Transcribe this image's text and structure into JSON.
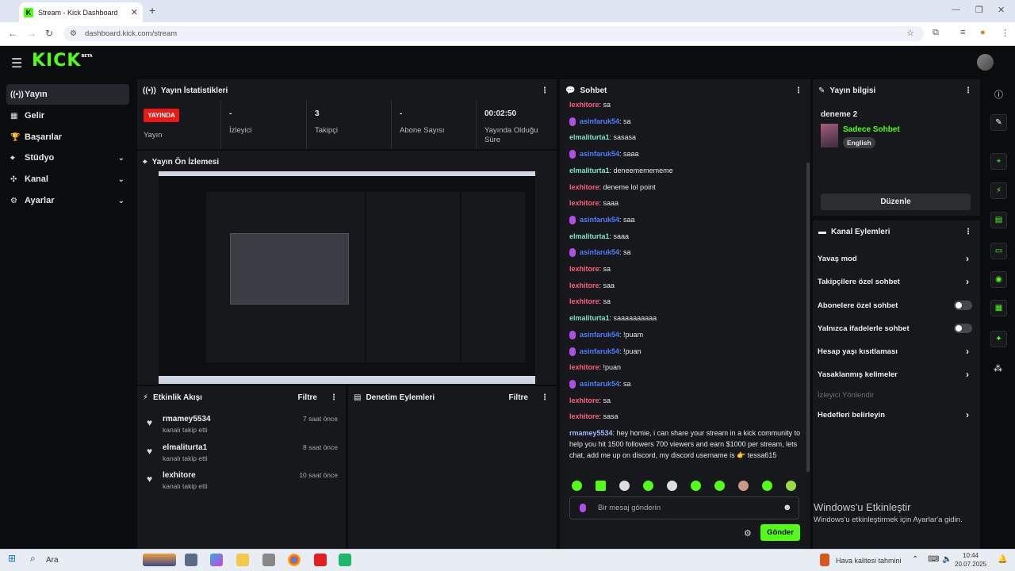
{
  "browser": {
    "tab_title": "Stream - Kick Dashboard",
    "url": "dashboard.kick.com/stream"
  },
  "app": {
    "logo": "KICK",
    "logo_badge": "BETA"
  },
  "sidebar": {
    "items": [
      {
        "label": "Yayın",
        "active": true
      },
      {
        "label": "Gelir"
      },
      {
        "label": "Başarılar"
      },
      {
        "label": "Stüdyo",
        "expandable": true
      },
      {
        "label": "Kanal",
        "expandable": true
      },
      {
        "label": "Ayarlar",
        "expandable": true
      }
    ]
  },
  "stats": {
    "title": "Yayın İstatistikleri",
    "live_badge": "YAYINDA",
    "status_label": "Yayın",
    "items": [
      {
        "value": "-",
        "label": "İzleyici"
      },
      {
        "value": "3",
        "label": "Takipçi"
      },
      {
        "value": "-",
        "label": "Abone Sayısı"
      },
      {
        "value": "00:02:50",
        "label": "Yayında Olduğu Süre"
      }
    ]
  },
  "preview": {
    "title": "Yayın Ön İzlemesi"
  },
  "activity": {
    "title": "Etkinlik Akışı",
    "filter": "Filtre",
    "items": [
      {
        "user": "rmamey5534",
        "action": "kanalı takip etti",
        "time": "7 saat önce"
      },
      {
        "user": "elmaliturta1",
        "action": "kanalı takip etti",
        "time": "8 saat önce"
      },
      {
        "user": "lexhitore",
        "action": "kanalı takip etti",
        "time": "10 saat önce"
      }
    ]
  },
  "moderation": {
    "title": "Denetim Eylemleri",
    "filter": "Filtre"
  },
  "chat": {
    "title": "Sohbet",
    "input_placeholder": "Bir mesaj gönderin",
    "send": "Gönder",
    "messages": [
      {
        "user": "lexhitore",
        "color": "#ff5f7a",
        "text": "sa",
        "mic": false
      },
      {
        "user": "asinfaruk54",
        "color": "#4f7dff",
        "text": "sa",
        "mic": true
      },
      {
        "user": "elmaliturta1",
        "color": "#7fe3c6",
        "text": "sasasa",
        "mic": false
      },
      {
        "user": "asinfaruk54",
        "color": "#4f7dff",
        "text": "saaa",
        "mic": true
      },
      {
        "user": "elmaliturta1",
        "color": "#7fe3c6",
        "text": "deneememememe",
        "mic": false
      },
      {
        "user": "lexhitore",
        "color": "#ff5f7a",
        "text": "deneme lol point",
        "mic": false
      },
      {
        "user": "lexhitore",
        "color": "#ff5f7a",
        "text": "saaa",
        "mic": false
      },
      {
        "user": "asinfaruk54",
        "color": "#4f7dff",
        "text": "saa",
        "mic": true
      },
      {
        "user": "elmaliturta1",
        "color": "#7fe3c6",
        "text": "saaa",
        "mic": false
      },
      {
        "user": "asinfaruk54",
        "color": "#4f7dff",
        "text": "sa",
        "mic": true
      },
      {
        "user": "lexhitore",
        "color": "#ff5f7a",
        "text": "sa",
        "mic": false
      },
      {
        "user": "lexhitore",
        "color": "#ff5f7a",
        "text": "saa",
        "mic": false
      },
      {
        "user": "lexhitore",
        "color": "#ff5f7a",
        "text": "sa",
        "mic": false
      },
      {
        "user": "elmaliturta1",
        "color": "#7fe3c6",
        "text": "saaaaaaaaaa",
        "mic": false
      },
      {
        "user": "asinfaruk54",
        "color": "#4f7dff",
        "text": "!puam",
        "mic": true
      },
      {
        "user": "asinfaruk54",
        "color": "#4f7dff",
        "text": "!puan",
        "mic": true
      },
      {
        "user": "lexhitore",
        "color": "#ff5f7a",
        "text": "!puan",
        "mic": false
      },
      {
        "user": "asinfaruk54",
        "color": "#4f7dff",
        "text": "sa",
        "mic": true
      },
      {
        "user": "lexhitore",
        "color": "#ff5f7a",
        "text": "sa",
        "mic": false
      },
      {
        "user": "lexhitore",
        "color": "#ff5f7a",
        "text": "sasa",
        "mic": false
      }
    ],
    "long_message": {
      "user": "rmamey5534",
      "color": "#9db8ff",
      "text": "hey homie, i can share your stream in a kick community to help you hit 1500 followers 700 viewers and earn $1000 per stream, lets chat, add me up on discord, my discord username is 👉 tessa615"
    }
  },
  "stream_info": {
    "title": "Yayın bilgisi",
    "stream_title": "deneme 2",
    "category": "Sadece Sohbet",
    "language": "English",
    "edit": "Düzenle"
  },
  "channel_actions": {
    "title": "Kanal Eylemleri",
    "items": [
      {
        "label": "Yavaş mod",
        "kind": "chevron"
      },
      {
        "label": "Takipçilere özel sohbet",
        "kind": "chevron"
      },
      {
        "label": "Abonelere özel sohbet",
        "kind": "toggle"
      },
      {
        "label": "Yalnızca ifadelerle sohbet",
        "kind": "toggle"
      },
      {
        "label": "Hesap yaşı kısıtlaması",
        "kind": "chevron"
      },
      {
        "label": "Yasaklanmış kelimeler",
        "kind": "chevron"
      },
      {
        "label": "İzleyici Yönlendir",
        "kind": "disabled"
      },
      {
        "label": "Hedefleri belirleyin",
        "kind": "chevron"
      }
    ]
  },
  "watermark": {
    "line1": "Windows'u Etkinleştir",
    "line2": "Windows'u etkinleştirmek için Ayarlar'a gidin."
  },
  "taskbar": {
    "search": "Ara",
    "weather": "Hava kalitesi tahmini",
    "time": "10:44",
    "date": "20.07.2025"
  },
  "colors": {
    "accent": "#53fc18",
    "live": "#e91916",
    "panel": "#17181b"
  }
}
